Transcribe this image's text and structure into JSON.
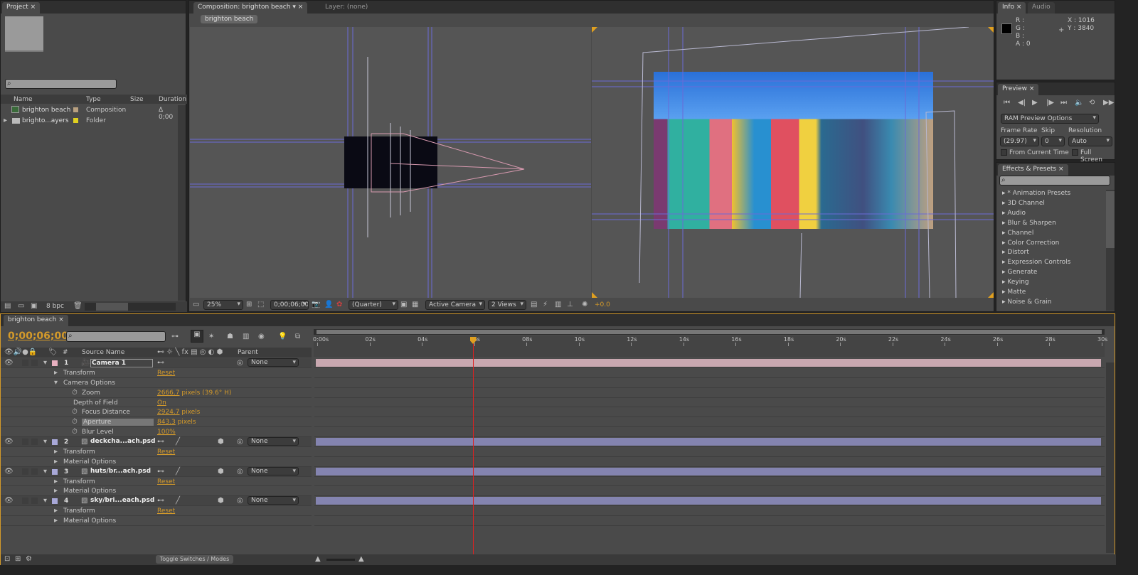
{
  "project": {
    "tab": "Project",
    "search_placeholder": "",
    "columns": [
      "Name",
      "Type",
      "Size",
      "Duration"
    ],
    "items": [
      {
        "name": "brighton beach",
        "type": "Composition",
        "label_color": "#b8a080",
        "duration": "Δ 0;00"
      },
      {
        "name": "brighto...ayers",
        "type": "Folder",
        "label_color": "#e0d020",
        "duration": ""
      }
    ],
    "bpc": "8 bpc"
  },
  "comp": {
    "tab": "Composition: brighton beach",
    "layer_tab": "Layer: (none)",
    "breadcrumb": "brighton beach",
    "toolbar": {
      "zoom": "25%",
      "timecode": "0;00;06;00",
      "resolution": "(Quarter)",
      "view": "Active Camera",
      "views": "2 Views",
      "exposure": "+0.0"
    }
  },
  "info": {
    "tab": "Info",
    "tab2": "Audio",
    "r": "R :",
    "g": "G :",
    "b": "B :",
    "a": "A : 0",
    "x": "X : 1016",
    "y": "Y : 3840"
  },
  "preview": {
    "tab": "Preview",
    "ram": "RAM Preview Options",
    "frame_rate_label": "Frame Rate",
    "skip_label": "Skip",
    "resolution_label": "Resolution",
    "frame_rate": "(29.97)",
    "skip": "0",
    "resolution": "Auto",
    "from_current": "From Current Time",
    "full_screen": "Full Screen"
  },
  "effects": {
    "tab": "Effects & Presets",
    "items": [
      "* Animation Presets",
      "3D Channel",
      "Audio",
      "Blur & Sharpen",
      "Channel",
      "Color Correction",
      "Distort",
      "Expression Controls",
      "Generate",
      "Keying",
      "Matte",
      "Noise & Grain"
    ]
  },
  "timeline": {
    "tab": "brighton beach",
    "current_time": "0;00;06;00",
    "header": {
      "num": "#",
      "source": "Source Name",
      "parent": "Parent"
    },
    "ruler": [
      "0:00s",
      "02s",
      "04s",
      "06s",
      "08s",
      "10s",
      "12s",
      "14s",
      "16s",
      "18s",
      "20s",
      "22s",
      "24s",
      "26s",
      "28s",
      "30s"
    ],
    "playhead_seconds": 6,
    "duration_seconds": 30,
    "rows": [
      {
        "kind": "layer",
        "num": "1",
        "name": "Camera 1",
        "color": "#e8b0c0",
        "parent": "None",
        "bar": "#c9a8b0"
      },
      {
        "kind": "group",
        "indent": 1,
        "name": "Transform",
        "value": "Reset",
        "open": false
      },
      {
        "kind": "group",
        "indent": 1,
        "name": "Camera Options",
        "value": "",
        "open": true
      },
      {
        "kind": "prop",
        "name": "Zoom",
        "value": "2666.7",
        "unit": " pixels (39.6° H)"
      },
      {
        "kind": "prop2",
        "name": "Depth of Field",
        "value": "On",
        "unit": ""
      },
      {
        "kind": "prop",
        "name": "Focus Distance",
        "value": "2924.7",
        "unit": " pixels"
      },
      {
        "kind": "prop",
        "name": "Aperture",
        "value": "843.3",
        "unit": " pixels",
        "selected": true
      },
      {
        "kind": "prop",
        "name": "Blur Level",
        "value": "100%",
        "unit": ""
      },
      {
        "kind": "layer",
        "num": "2",
        "name": "deckcha...ach.psd",
        "color": "#a8a8d8",
        "parent": "None",
        "bar": "#8484b0"
      },
      {
        "kind": "group",
        "indent": 1,
        "name": "Transform",
        "value": "Reset",
        "open": false
      },
      {
        "kind": "group",
        "indent": 1,
        "name": "Material Options",
        "value": "",
        "open": false
      },
      {
        "kind": "layer",
        "num": "3",
        "name": "huts/br...ach.psd",
        "color": "#a8a8d8",
        "parent": "None",
        "bar": "#8484b0"
      },
      {
        "kind": "group",
        "indent": 1,
        "name": "Transform",
        "value": "Reset",
        "open": false
      },
      {
        "kind": "group",
        "indent": 1,
        "name": "Material Options",
        "value": "",
        "open": false
      },
      {
        "kind": "layer",
        "num": "4",
        "name": "sky/bri...each.psd",
        "color": "#a8a8d8",
        "parent": "None",
        "bar": "#8484b0"
      },
      {
        "kind": "group",
        "indent": 1,
        "name": "Transform",
        "value": "Reset",
        "open": false
      },
      {
        "kind": "group",
        "indent": 1,
        "name": "Material Options",
        "value": "",
        "open": false
      }
    ],
    "toggle": "Toggle Switches / Modes"
  },
  "colors": {
    "accent": "#d49a2a",
    "playhead": "#e02020",
    "guide": "#6a6ad8"
  }
}
